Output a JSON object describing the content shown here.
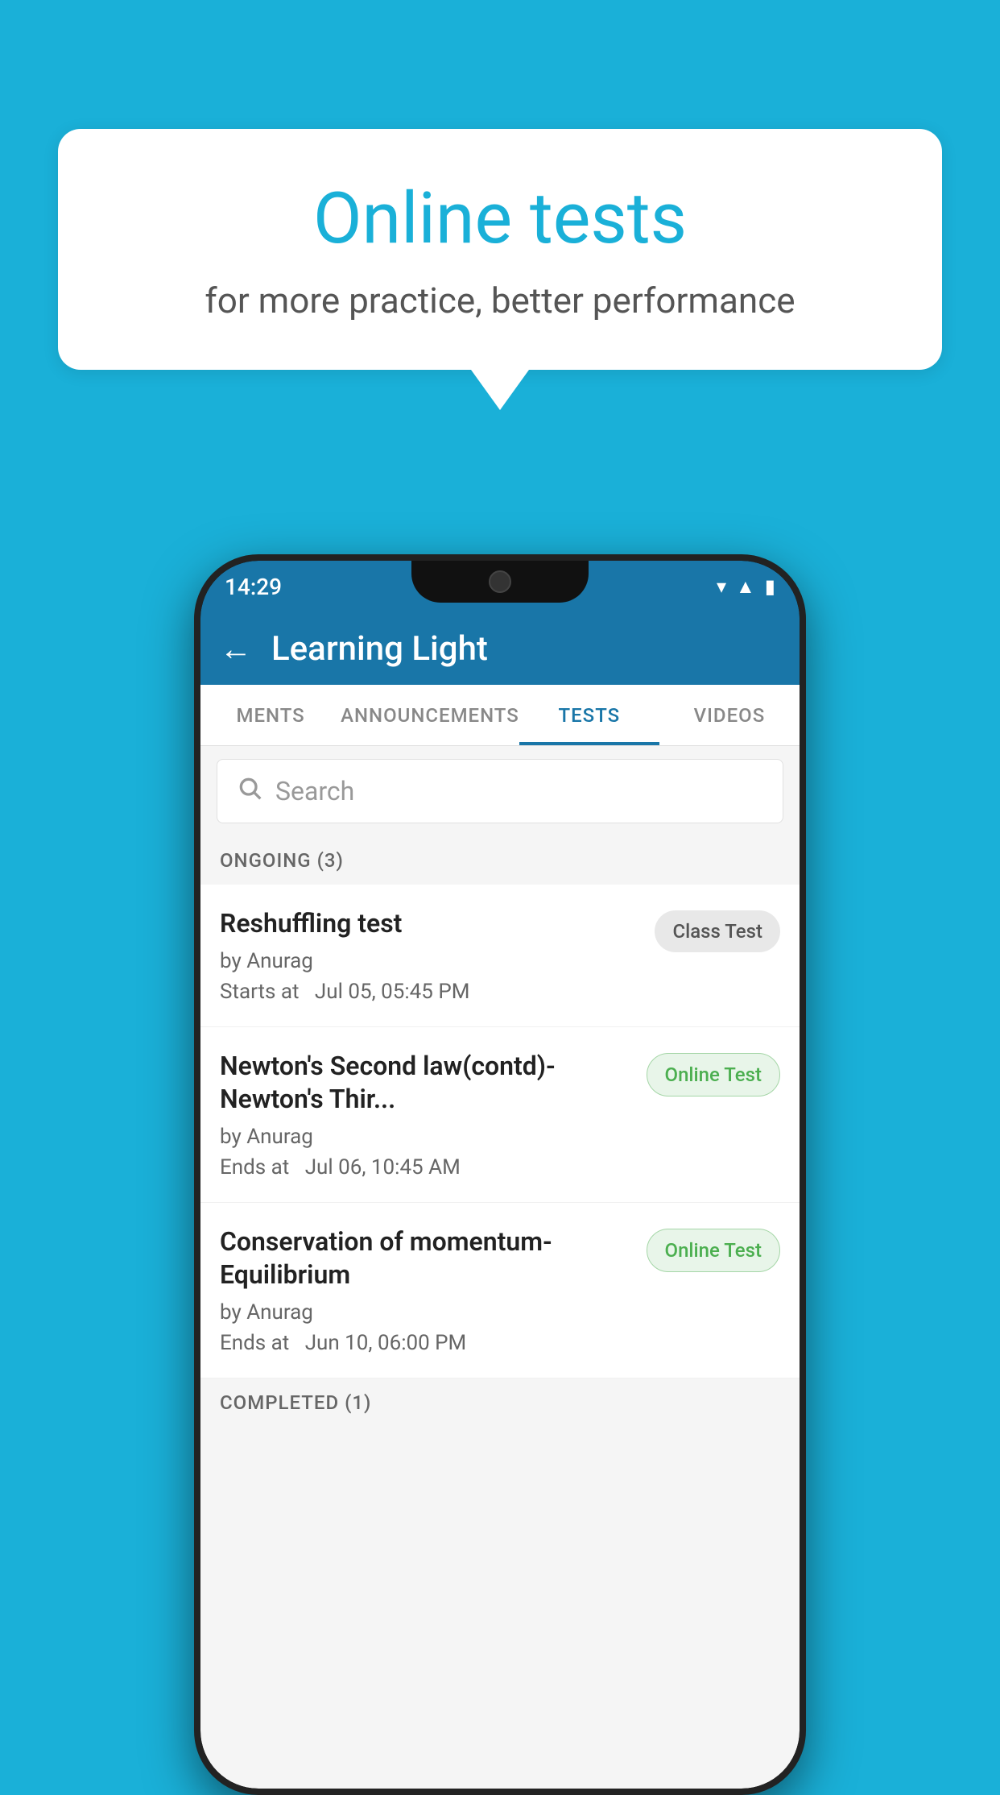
{
  "background_color": "#1ab0d8",
  "speech_bubble": {
    "title": "Online tests",
    "subtitle": "for more practice, better performance"
  },
  "status_bar": {
    "time": "14:29",
    "wifi": "▾",
    "signal": "▲",
    "battery": "▮"
  },
  "app_header": {
    "title": "Learning Light",
    "back_label": "←"
  },
  "tabs": [
    {
      "label": "MENTS",
      "active": false
    },
    {
      "label": "ANNOUNCEMENTS",
      "active": false
    },
    {
      "label": "TESTS",
      "active": true
    },
    {
      "label": "VIDEOS",
      "active": false
    }
  ],
  "search": {
    "placeholder": "Search"
  },
  "ongoing_section": {
    "label": "ONGOING (3)"
  },
  "tests": [
    {
      "name": "Reshuffling test",
      "author": "by Anurag",
      "time_label": "Starts at",
      "time": "Jul 05, 05:45 PM",
      "badge": "Class Test",
      "badge_type": "class"
    },
    {
      "name": "Newton's Second law(contd)-Newton's Thir...",
      "author": "by Anurag",
      "time_label": "Ends at",
      "time": "Jul 06, 10:45 AM",
      "badge": "Online Test",
      "badge_type": "online"
    },
    {
      "name": "Conservation of momentum-Equilibrium",
      "author": "by Anurag",
      "time_label": "Ends at",
      "time": "Jun 10, 06:00 PM",
      "badge": "Online Test",
      "badge_type": "online"
    }
  ],
  "completed_section": {
    "label": "COMPLETED (1)"
  }
}
